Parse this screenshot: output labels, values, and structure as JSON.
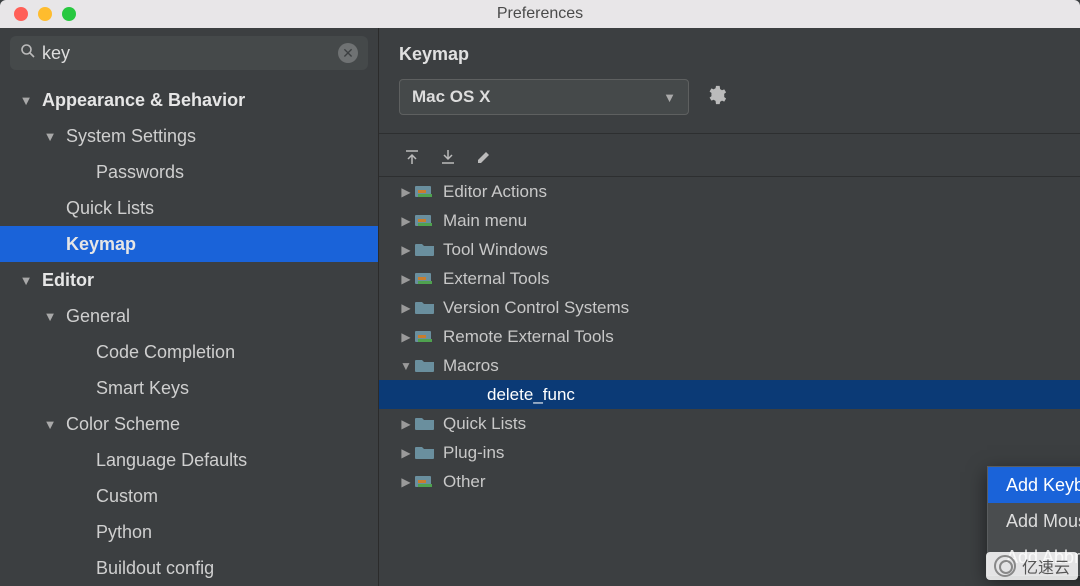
{
  "window": {
    "title": "Preferences"
  },
  "search": {
    "value": "key",
    "placeholder": ""
  },
  "sidebar": {
    "items": [
      {
        "label": "Appearance & Behavior",
        "level": 0,
        "expand": "down",
        "bold": true
      },
      {
        "label": "System Settings",
        "level": 1,
        "expand": "down",
        "bold": false
      },
      {
        "label": "Passwords",
        "level": 2,
        "expand": "",
        "bold": false
      },
      {
        "label": "Quick Lists",
        "level": 1,
        "expand": "",
        "bold": false
      },
      {
        "label": "Keymap",
        "level": 1,
        "expand": "",
        "bold": true,
        "selected": true
      },
      {
        "label": "Editor",
        "level": 0,
        "expand": "down",
        "bold": true
      },
      {
        "label": "General",
        "level": 1,
        "expand": "down",
        "bold": false
      },
      {
        "label": "Code Completion",
        "level": 2,
        "expand": "",
        "bold": false
      },
      {
        "label": "Smart Keys",
        "level": 2,
        "expand": "",
        "bold": false
      },
      {
        "label": "Color Scheme",
        "level": 1,
        "expand": "down",
        "bold": false
      },
      {
        "label": "Language Defaults",
        "level": 2,
        "expand": "",
        "bold": false
      },
      {
        "label": "Custom",
        "level": 2,
        "expand": "",
        "bold": false
      },
      {
        "label": "Python",
        "level": 2,
        "expand": "",
        "bold": false
      },
      {
        "label": "Buildout config",
        "level": 2,
        "expand": "",
        "bold": false
      }
    ]
  },
  "main": {
    "title": "Keymap",
    "keymap_selected": "Mac OS X",
    "toolbar": {
      "expand": "expand-all",
      "collapse": "collapse-all",
      "edit": "edit"
    },
    "actions": [
      {
        "label": "Editor Actions",
        "lvl": 1,
        "exp": "right",
        "icon": "stack"
      },
      {
        "label": "Main menu",
        "lvl": 1,
        "exp": "right",
        "icon": "stack"
      },
      {
        "label": "Tool Windows",
        "lvl": 1,
        "exp": "right",
        "icon": "folder"
      },
      {
        "label": "External Tools",
        "lvl": 1,
        "exp": "right",
        "icon": "stack"
      },
      {
        "label": "Version Control Systems",
        "lvl": 1,
        "exp": "right",
        "icon": "folder"
      },
      {
        "label": "Remote External Tools",
        "lvl": 1,
        "exp": "right",
        "icon": "stack"
      },
      {
        "label": "Macros",
        "lvl": 1,
        "exp": "down",
        "icon": "folder"
      },
      {
        "label": "delete_func",
        "lvl": 2,
        "exp": "",
        "icon": "",
        "selected": true
      },
      {
        "label": "Quick Lists",
        "lvl": 1,
        "exp": "right",
        "icon": "folder"
      },
      {
        "label": "Plug-ins",
        "lvl": 1,
        "exp": "right",
        "icon": "folder"
      },
      {
        "label": "Other",
        "lvl": 1,
        "exp": "right",
        "icon": "stack"
      }
    ],
    "context_menu": [
      {
        "label": "Add Keyboard Shortcut",
        "highlight": true
      },
      {
        "label": "Add Mouse Shortcut",
        "highlight": false
      },
      {
        "label": "Add Abbreviation",
        "highlight": false
      }
    ]
  },
  "watermark": "亿速云"
}
